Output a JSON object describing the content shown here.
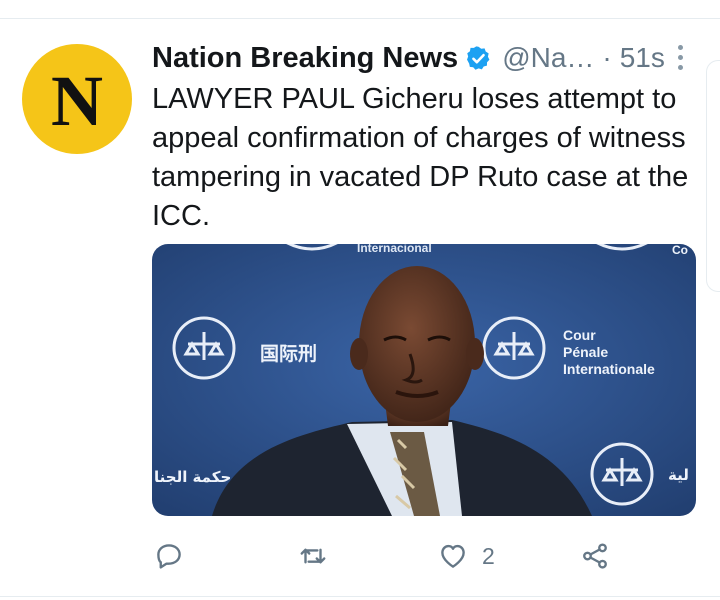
{
  "tweet": {
    "avatar_letter": "N",
    "display_name": "Nation Breaking News",
    "handle": "@Na…",
    "separator": "·",
    "time": "51s",
    "text": "LAWYER PAUL Gicheru loses attempt to appeal confirmation of charges of witness tampering in vacated DP Ruto case at the ICC.",
    "verified": true,
    "media": {
      "backdrop_text": {
        "top": "Internacional",
        "chinese": "国际刑",
        "court_line1": "Cour",
        "court_line2": "Pénale",
        "court_line3": "Internationale",
        "arabic_left": "حكمة الجنا",
        "arabic_right": "لية",
        "corner": "Co"
      }
    },
    "actions": {
      "reply_icon": "reply-icon",
      "retweet_icon": "retweet-icon",
      "like_icon": "heart-icon",
      "like_count": "2",
      "share_icon": "share-icon"
    }
  },
  "colors": {
    "avatar_bg": "#f5c518",
    "verified_blue": "#1da1f2",
    "muted_text": "#657786",
    "icon_gray": "#657786",
    "backdrop_blue": "#2c4f8a"
  }
}
